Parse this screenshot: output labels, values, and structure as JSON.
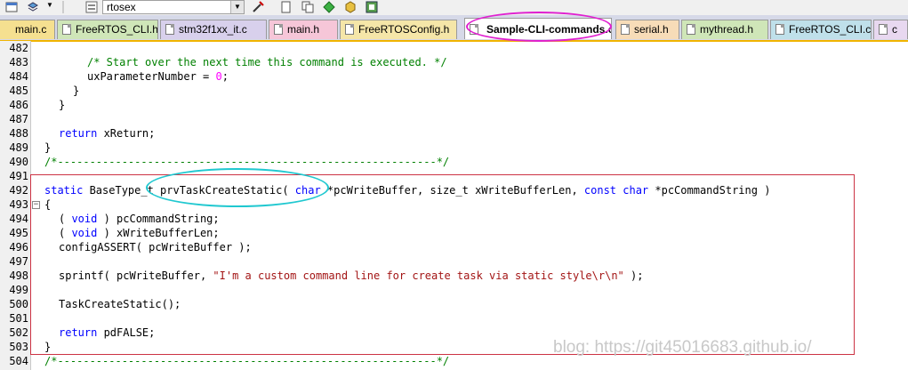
{
  "toolbar": {
    "project_name": "rtosex"
  },
  "tabs": [
    {
      "label": "main.c"
    },
    {
      "label": "FreeRTOS_CLI.h"
    },
    {
      "label": "stm32f1xx_it.c"
    },
    {
      "label": "main.h"
    },
    {
      "label": "FreeRTOSConfig.h"
    },
    {
      "label": "Sample-CLI-commands.c",
      "active": true
    },
    {
      "label": "serial.h"
    },
    {
      "label": "mythread.h"
    },
    {
      "label": "FreeRTOS_CLI.c"
    },
    {
      "label": "c"
    }
  ],
  "editor": {
    "line_numbers": [
      "482",
      "483",
      "484",
      "485",
      "486",
      "487",
      "488",
      "489",
      "490",
      "491",
      "492",
      "493",
      "494",
      "495",
      "496",
      "497",
      "498",
      "499",
      "500",
      "501",
      "502",
      "503",
      "504"
    ],
    "lines": {
      "l483": "/* Start over the next time this command is executed. */",
      "l484_a": "uxParameterNumber = ",
      "l484_b": "0",
      "l484_c": ";",
      "l485": "}",
      "l486": "}",
      "l488_a": "return",
      "l488_b": " xReturn;",
      "l489": "}",
      "l490": "/*-----------------------------------------------------------*/",
      "l492_a": "static",
      "l492_b": " BaseType_t prvTaskCreateStatic( ",
      "l492_c": "char",
      "l492_d": " *pcWriteBuffer, size_t xWriteBufferLen, ",
      "l492_e": "const char",
      "l492_f": " *pcCommandString )",
      "l493": "{",
      "l494_a": "( ",
      "l494_b": "void",
      "l494_c": " ) pcCommandString;",
      "l495_a": "( ",
      "l495_b": "void",
      "l495_c": " ) xWriteBufferLen;",
      "l496": "configASSERT( pcWriteBuffer );",
      "l498_a": "sprintf( pcWriteBuffer, ",
      "l498_b": "\"I'm a custom command line for create task via static style\\r\\n\"",
      "l498_c": " );",
      "l500": "TaskCreateStatic();",
      "l502_a": "return",
      "l502_b": " pdFALSE;",
      "l503": "}",
      "l504": "/*-----------------------------------------------------------*/"
    }
  },
  "watermark": "blog: https://git45016683.github.io/",
  "colors": {
    "comment": "#008000",
    "keyword": "#0000ff",
    "number": "#ff00ff",
    "string": "#a31515",
    "highlight_box": "#cc3344",
    "tab_ring": "#e020d0",
    "code_ring": "#20c8d0"
  }
}
